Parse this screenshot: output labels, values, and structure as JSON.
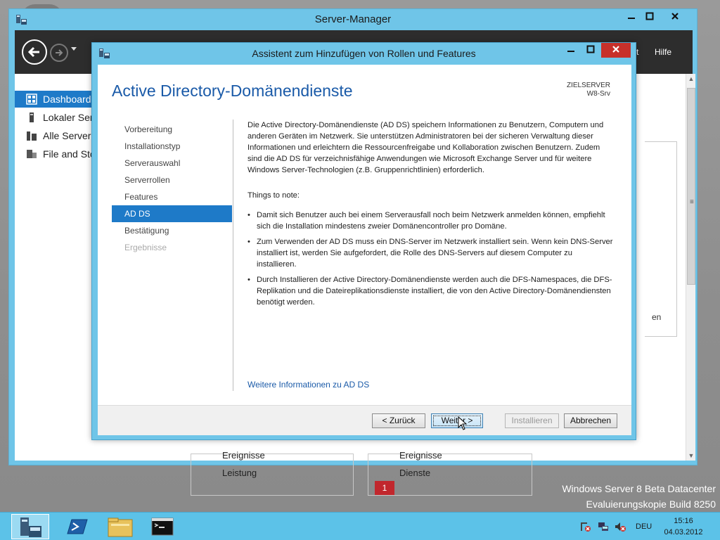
{
  "desktop": {
    "watermark_line1": "Windows Server 8 Beta Datacenter",
    "watermark_line2": "Evaluierungskopie Build 8250"
  },
  "server_manager": {
    "title": "Server-Manager",
    "menu_partial": "t",
    "menu_help": "Hilfe",
    "sidebar": [
      {
        "label": "Dashboard",
        "icon": "dashboard-icon",
        "active": true
      },
      {
        "label": "Lokaler Server",
        "icon": "server-icon",
        "active": false
      },
      {
        "label": "Alle Server",
        "icon": "servers-icon",
        "active": false
      },
      {
        "label": "File and Storage Services",
        "icon": "storage-icon",
        "active": false
      }
    ],
    "fragment_right": "en",
    "tile_left": {
      "line1": "Ereignisse",
      "line2": "Leistung"
    },
    "tile_right": {
      "line1": "Ereignisse",
      "badge": "1",
      "line2": "Dienste"
    }
  },
  "wizard": {
    "title": "Assistent zum Hinzufügen von Rollen und Features",
    "heading": "Active Directory-Domänendienste",
    "target_label": "ZIELSERVER",
    "target_value": "W8-Srv",
    "steps": [
      {
        "label": "Vorbereitung",
        "state": "normal"
      },
      {
        "label": "Installationstyp",
        "state": "normal"
      },
      {
        "label": "Serverauswahl",
        "state": "normal"
      },
      {
        "label": "Serverrollen",
        "state": "normal"
      },
      {
        "label": "Features",
        "state": "normal"
      },
      {
        "label": "AD DS",
        "state": "active"
      },
      {
        "label": "Bestätigung",
        "state": "normal"
      },
      {
        "label": "Ergebnisse",
        "state": "disabled"
      }
    ],
    "intro": "Die Active Directory-Domänendienste (AD DS) speichern Informationen zu Benutzern, Computern und anderen Geräten im Netzwerk. Sie unterstützen Administratoren bei der sicheren Verwaltung dieser Informationen und erleichtern die Ressourcenfreigabe und Kollaboration zwischen Benutzern. Zudem sind die AD DS für verzeichnisfähige Anwendungen wie Microsoft Exchange Server und für weitere Windows Server-Technologien (z.B. Gruppenrichtlinien) erforderlich.",
    "notes_title": "Things to note:",
    "notes": [
      "Damit sich Benutzer auch bei einem Serverausfall noch beim Netzwerk anmelden können, empfiehlt sich die Installation mindestens zweier Domänencontroller pro Domäne.",
      "Zum Verwenden der AD DS muss ein DNS-Server im Netzwerk installiert sein. Wenn kein DNS-Server installiert ist, werden Sie aufgefordert, die Rolle des DNS-Servers auf diesem Computer zu installieren.",
      "Durch Installieren der Active Directory-Domänendienste werden auch die DFS-Namespaces, die DFS-Replikation und die Dateireplikationsdienste installiert, die von den Active Directory-Domänendiensten benötigt werden."
    ],
    "more_link": "Weitere Informationen zu AD DS",
    "buttons": {
      "back": "< Zurück",
      "next": "Weiter >",
      "install": "Installieren",
      "cancel": "Abbrechen"
    }
  },
  "taskbar": {
    "items": [
      "server-manager-icon",
      "powershell-icon",
      "explorer-icon",
      "cmd-icon"
    ],
    "language": "DEU",
    "time": "15:16",
    "date": "04.03.2012"
  },
  "colors": {
    "accent": "#1e7ac8",
    "window_frame": "#6fc5e8",
    "close_red": "#c7302a",
    "heading_blue": "#1a5aa8"
  }
}
